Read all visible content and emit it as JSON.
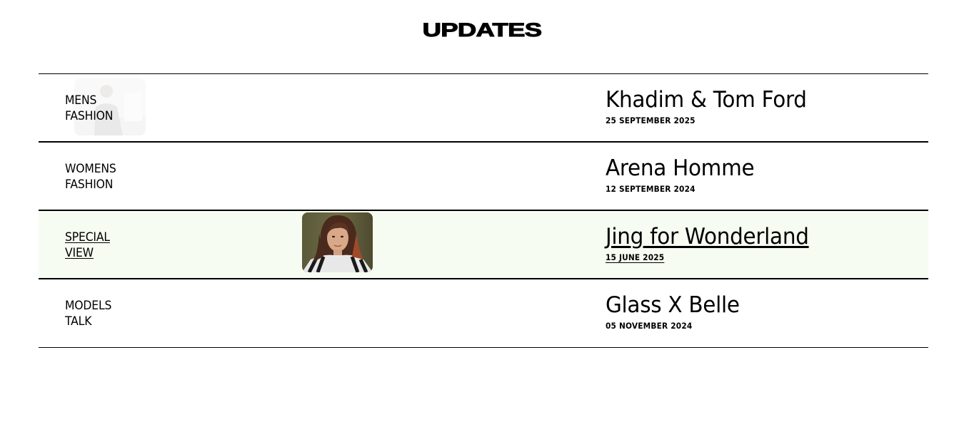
{
  "page": {
    "title": "UPDATES"
  },
  "updates": [
    {
      "category_line1": "MENS",
      "category_line2": "FASHION",
      "headline": "Khadim & Tom Ford",
      "date": "25 SEPTEMBER 2025",
      "state": "hover-fading",
      "thumbnail": "person-suit-photo"
    },
    {
      "category_line1": "WOMENS",
      "category_line2": "FASHION",
      "headline": "Arena Homme",
      "date": "12 SEPTEMBER 2024",
      "state": "default",
      "thumbnail": ""
    },
    {
      "category_line1": "SPECIAL",
      "category_line2": "VIEW",
      "headline": "Jing for Wonderland",
      "date": "15 JUNE 2025",
      "state": "active",
      "thumbnail": "woman-portrait-photo"
    },
    {
      "category_line1": "MODELS",
      "category_line2": "TALK",
      "headline": "Glass X Belle",
      "date": "05 NOVEMBER 2024",
      "state": "default",
      "thumbnail": ""
    }
  ],
  "colors": {
    "text": "#000000",
    "background": "#ffffff",
    "active_row_background": "#f6fcf1",
    "divider": "#000000"
  }
}
